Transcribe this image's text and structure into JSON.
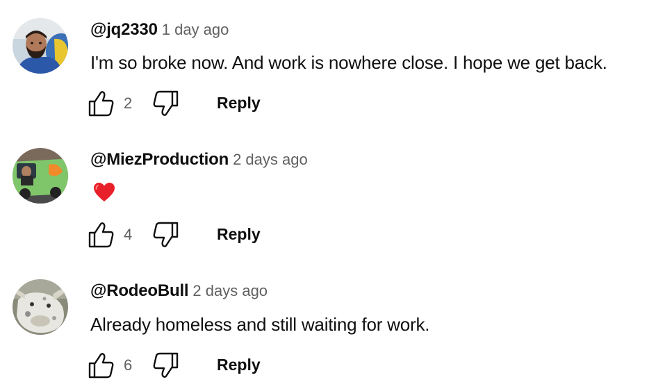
{
  "comments": [
    {
      "author": "@jq2330",
      "timestamp": "1 day ago",
      "text": "I'm so broke now. And work is nowhere close. I hope we get back.",
      "likes": "2",
      "reply_label": "Reply",
      "avatar_icon": "man-with-beard-avatar"
    },
    {
      "author": "@MiezProduction",
      "timestamp": "2 days ago",
      "emoji": "red-heart-emoji",
      "likes": "4",
      "reply_label": "Reply",
      "avatar_icon": "van-avatar"
    },
    {
      "author": "@RodeoBull",
      "timestamp": "2 days ago",
      "text": "Already homeless and still waiting for work.",
      "likes": "6",
      "reply_label": "Reply",
      "avatar_icon": "bull-avatar"
    }
  ],
  "colors": {
    "text_primary": "#0f0f0f",
    "text_secondary": "#606060",
    "heart": "#e8202a"
  }
}
